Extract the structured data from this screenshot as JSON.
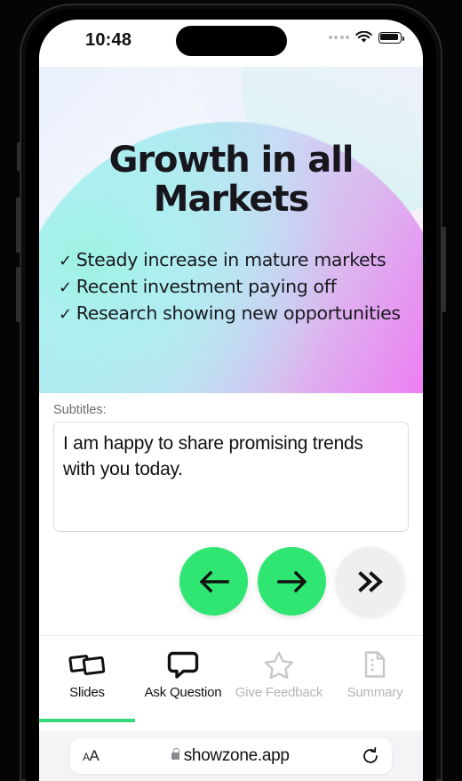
{
  "status_bar": {
    "time": "10:48",
    "signal_icon": "signal-dots-icon",
    "wifi_icon": "wifi-icon",
    "battery_icon": "battery-full-icon"
  },
  "slide": {
    "title": "Growth in all Markets",
    "bullets": [
      {
        "check": "✓",
        "text": "Steady increase in mature markets"
      },
      {
        "check": "✓",
        "text": "Recent investment paying off"
      },
      {
        "check": "✓",
        "text": "Research showing new opportunities"
      }
    ],
    "gradient_colors": {
      "teal": "#7fe9dc",
      "lavender": "#cbd9f5",
      "magenta": "#f36cf0",
      "background": "#f3f6fd"
    }
  },
  "subtitles": {
    "label": "Subtitles:",
    "value": "I am happy to share promising trends with you today."
  },
  "controls": {
    "previous": {
      "label": "←",
      "name": "previous-slide-button",
      "color": "#2fe673"
    },
    "next": {
      "label": "→",
      "name": "next-slide-button",
      "color": "#2fe673"
    },
    "skip": {
      "label": "»",
      "name": "skip-forward-button",
      "color": "#efefef"
    }
  },
  "tabs": [
    {
      "label": "Slides",
      "icon": "slides-icon",
      "state": "active"
    },
    {
      "label": "Ask Question",
      "icon": "chat-bubble-icon",
      "state": "enabled"
    },
    {
      "label": "Give Feedback",
      "icon": "star-icon",
      "state": "disabled"
    },
    {
      "label": "Summary",
      "icon": "document-icon",
      "state": "disabled"
    }
  ],
  "tab_accent_color": "#36d977",
  "browser": {
    "text_size_label": "AA",
    "lock_icon": "lock-icon",
    "url": "showzone.app",
    "reload_icon": "reload-icon"
  }
}
